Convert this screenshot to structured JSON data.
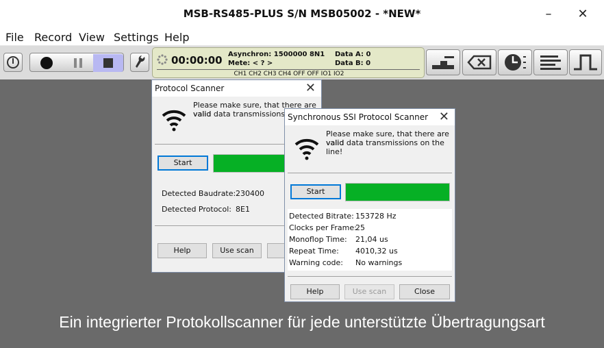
{
  "window": {
    "title": "MSB-RS485-PLUS S/N MSB05002 - *NEW*",
    "minimize_icon": "minimize-icon",
    "close_icon": "close-icon"
  },
  "menu": {
    "items": [
      "File",
      "Record",
      "View",
      "Settings",
      "Help"
    ]
  },
  "toolbar": {
    "record_state": "stop",
    "icons": [
      "power-icon",
      "record-icon",
      "pause-icon",
      "stop-icon",
      "wrench-icon",
      "trigger-icon",
      "clear-icon",
      "clock-icon",
      "list-icon",
      "pulse-icon"
    ]
  },
  "status": {
    "time": "00:00:00",
    "mode": "Asynchron: 1500000 8N1",
    "mete": "Mete: < ? >",
    "data_a": "Data A: 0",
    "data_b": "Data B: 0",
    "channels": "CH1 CH2 CH3 CH4 OFF OFF IO1 IO2"
  },
  "protocol_scanner": {
    "title": "Protocol Scanner",
    "message_line1": "Please make sure, that there are valid",
    "message_line2": "valid data transmissions on",
    "start_label": "Start",
    "progress": 1.0,
    "baudrate_label": "Detected Baudrate:",
    "baudrate_value": "230400",
    "protocol_label": "Detected Protocol:",
    "protocol_value": "8E1",
    "help_label": "Help",
    "use_scan_label": "Use scan",
    "close_label_partial": "C"
  },
  "ssi_scanner": {
    "title": "Synchronous SSI Protocol Scanner",
    "message_line1": "Please make sure, that there are valid",
    "message_line2": "valid data transmissions on the line!",
    "start_label": "Start",
    "progress": 1.0,
    "rows": [
      {
        "label": "Detected Bitrate:",
        "value": "153728 Hz"
      },
      {
        "label": "Clocks per Frame:",
        "value": "25"
      },
      {
        "label": "Monoflop Time:",
        "value": "21,04 us"
      },
      {
        "label": "Repeat Time:",
        "value": "4010,32 us"
      },
      {
        "label": "Warning code:",
        "value": "No warnings"
      }
    ],
    "help_label": "Help",
    "use_scan_label": "Use scan",
    "close_label": "Close"
  },
  "caption": "Ein integrierter Protokollscanner für jede unterstützte Übertragungsart",
  "colors": {
    "background": "#6a6a6a",
    "progress_green": "#06b025",
    "status_panel": "#e4e8c8",
    "stop_active": "#b8b8f2",
    "focus_blue": "#0078d7"
  }
}
